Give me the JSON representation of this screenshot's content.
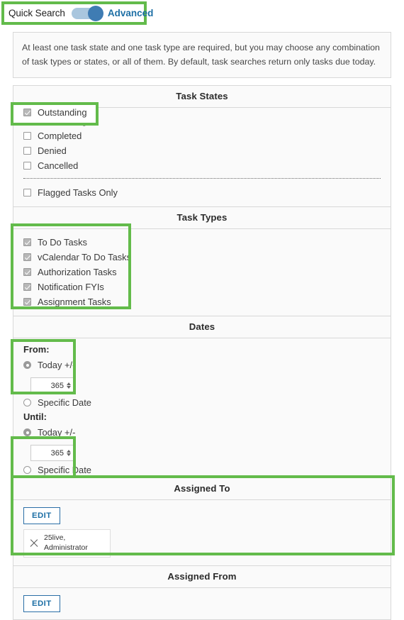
{
  "toggle": {
    "left_label": "Quick Search",
    "right_label": "Advanced",
    "state": "advanced",
    "accent_color": "#1d6fa5",
    "track_color": "#a9c6de",
    "knob_color": "#3f7cb3"
  },
  "highlight_color": "#63bb4b",
  "notice": {
    "text": "At least one task state and one task type are required, but you may choose any combination of task types or states, or all of them. By default, task searches return only tasks due today."
  },
  "task_states": {
    "title": "Task States",
    "options": [
      {
        "label": "Outstanding",
        "checked": true
      },
      {
        "label": "Completed",
        "checked": false
      },
      {
        "label": "Denied",
        "checked": false
      },
      {
        "label": "Cancelled",
        "checked": false
      }
    ],
    "flagged": {
      "label": "Flagged Tasks Only",
      "checked": false
    }
  },
  "task_types": {
    "title": "Task Types",
    "options": [
      {
        "label": "To Do Tasks",
        "checked": true
      },
      {
        "label": "vCalendar To Do Tasks",
        "checked": true
      },
      {
        "label": "Authorization Tasks",
        "checked": true
      },
      {
        "label": "Notification FYIs",
        "checked": true
      },
      {
        "label": "Assignment Tasks",
        "checked": true
      }
    ]
  },
  "dates": {
    "title": "Dates",
    "from": {
      "title": "From:",
      "today_label": "Today +/-",
      "today_selected": true,
      "offset_value": "365",
      "specific_label": "Specific Date",
      "specific_selected": false
    },
    "until": {
      "title": "Until:",
      "today_label": "Today +/-",
      "today_selected": true,
      "offset_value": "365",
      "specific_label": "Specific Date",
      "specific_selected": false
    }
  },
  "assigned_to": {
    "title": "Assigned To",
    "edit_label": "EDIT",
    "chips": [
      {
        "line1": "25live,",
        "line2": "Administrator",
        "remove_icon": "close-icon"
      }
    ]
  },
  "assigned_from": {
    "title": "Assigned From",
    "edit_label": "EDIT"
  }
}
